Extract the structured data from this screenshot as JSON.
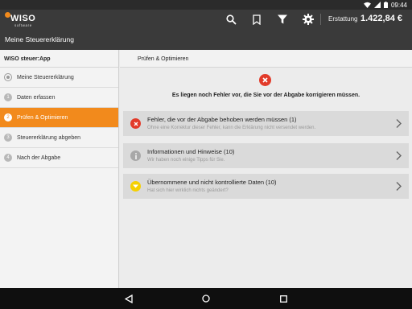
{
  "status_bar": {
    "time": "09:44"
  },
  "app_bar": {
    "brand": "WISO",
    "brand_sub": "software",
    "title": "Meine Steuererklärung",
    "refund_label": "Erstattung",
    "refund_value": "1.422,84 €",
    "icons": [
      "search-icon",
      "bookmark-icon",
      "filter-icon",
      "gear-icon"
    ],
    "accent_color": "#f28a1c"
  },
  "sidebar": {
    "header": "WISO steuer:App",
    "items": [
      {
        "label": "Meine Steuererklärung",
        "marker": "",
        "active": false
      },
      {
        "label": "Daten erfassen",
        "marker": "1",
        "active": false
      },
      {
        "label": "Prüfen & Optimieren",
        "marker": "2",
        "active": true
      },
      {
        "label": "Steuererklärung abgeben",
        "marker": "3",
        "active": false
      },
      {
        "label": "Nach der Abgabe",
        "marker": "4",
        "active": false
      }
    ]
  },
  "main": {
    "header": "Prüfen & Optimieren",
    "message": "Es liegen noch Fehler vor, die Sie vor der Abgabe korrigieren müssen.",
    "cards": [
      {
        "title": "Fehler, die vor der Abgabe behoben werden müssen (1)",
        "subtitle": "Ohne eine Korrektur dieser Fehler, kann die Erklärung nicht versendet werden.",
        "icon": "error-icon",
        "color": "#e23b2a"
      },
      {
        "title": "Informationen und Hinweise (10)",
        "subtitle": "Wir haben noch einige Tipps für Sie.",
        "icon": "info-icon",
        "color": "#a8a8a8"
      },
      {
        "title": "Übernommene und nicht kontrollierte Daten (10)",
        "subtitle": "Hat sich hier wirklich nichts geändert?",
        "icon": "caret-down-icon",
        "color": "#f5d000"
      }
    ]
  }
}
